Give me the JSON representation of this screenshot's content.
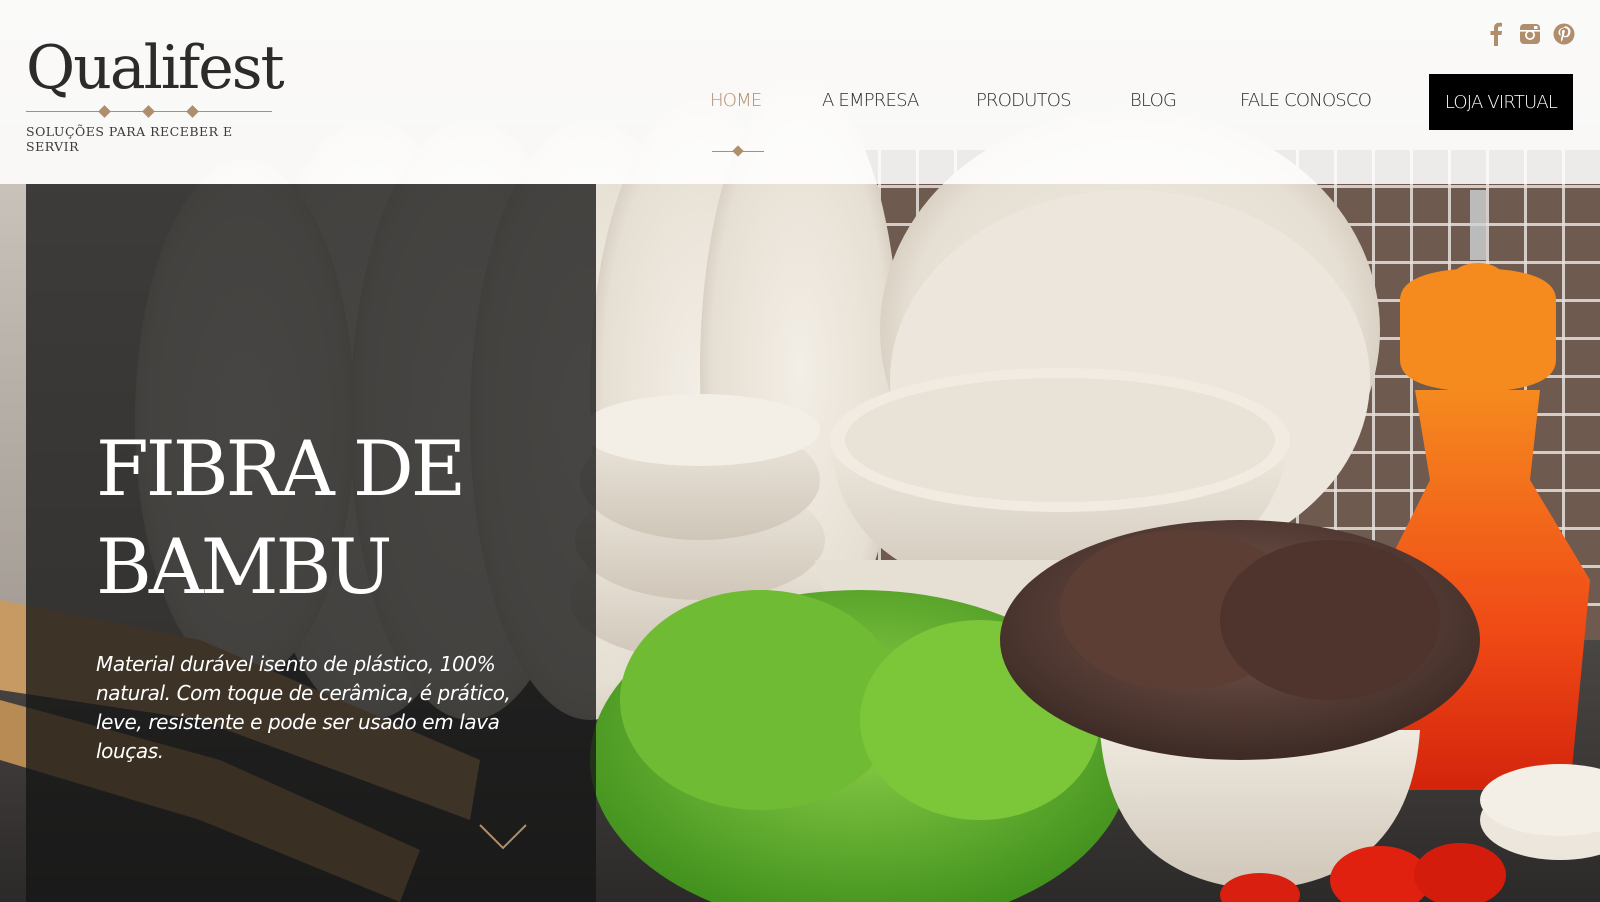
{
  "brand": {
    "name": "Qualifest",
    "tagline": "SOLUÇÕES PARA RECEBER E SERVIR",
    "accent_color": "#b08d6b"
  },
  "social": [
    {
      "name": "facebook",
      "icon": "facebook-icon"
    },
    {
      "name": "instagram",
      "icon": "instagram-icon"
    },
    {
      "name": "pinterest",
      "icon": "pinterest-icon"
    }
  ],
  "nav": {
    "items": [
      {
        "label": "HOME",
        "active": true
      },
      {
        "label": "A EMPRESA"
      },
      {
        "label": "PRODUTOS"
      },
      {
        "label": "BLOG"
      },
      {
        "label": "FALE CONOSCO"
      }
    ],
    "cta_label": "LOJA VIRTUAL"
  },
  "hero": {
    "title_line1": "FIBRA DE",
    "title_line2": "BAMBU",
    "description": "Material durável isento de plástico, 100% natural. Com toque de cerâmica, é prático, leve, resistente e pode ser usado em lava louças.",
    "scroll_icon": "chevron-down-icon"
  }
}
